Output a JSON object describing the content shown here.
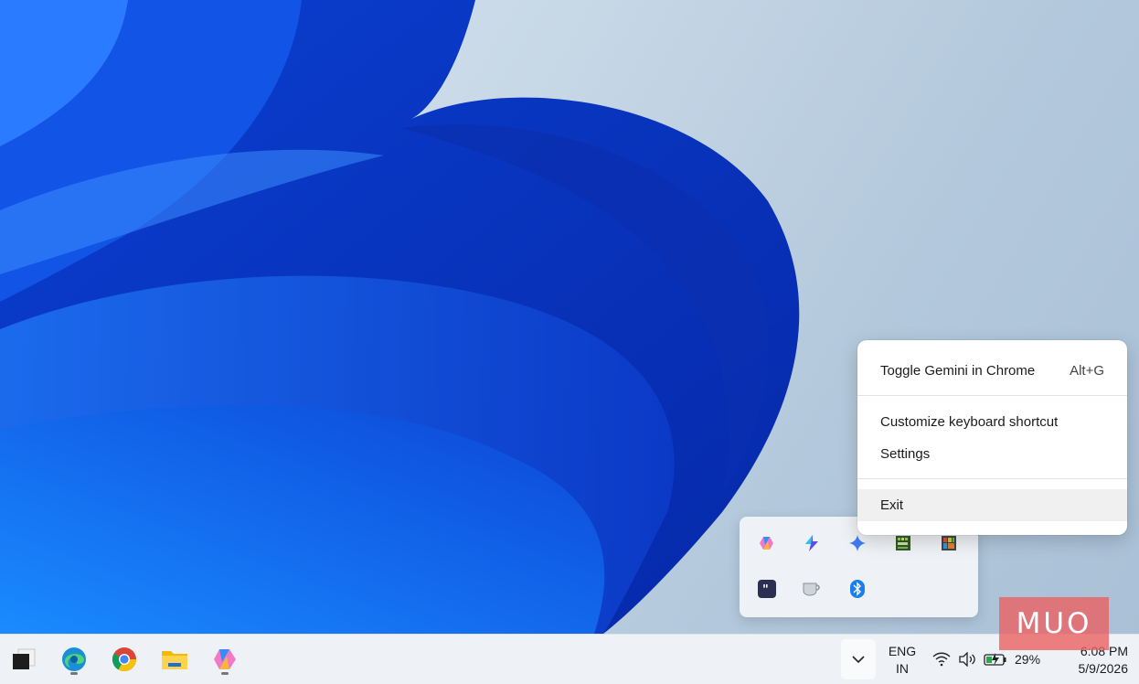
{
  "context_menu": {
    "items": [
      {
        "label": "Toggle Gemini in Chrome",
        "shortcut": "Alt+G"
      },
      {
        "label": "Customize keyboard shortcut"
      },
      {
        "label": "Settings"
      },
      {
        "label": "Exit",
        "highlighted": true
      }
    ]
  },
  "tray_overflow": {
    "icons": [
      "copilot-icon",
      "power-automate-icon",
      "gemini-sparkle-icon",
      "keyboard-app-icon",
      "palette-app-icon",
      "quote-app-icon",
      "coffee-cup-icon",
      "bluetooth-icon"
    ]
  },
  "taskbar": {
    "apps": [
      "task-view-icon",
      "edge-icon",
      "chrome-icon",
      "file-explorer-icon",
      "copilot-icon"
    ],
    "language": {
      "line1": "ENG",
      "line2": "IN"
    },
    "battery_percent": "29%",
    "time": "6:08 PM",
    "date": "5/9/2026"
  },
  "watermark": "MUO",
  "colors": {
    "accent": "#1f5fe0",
    "menu_bg": "#ffffff",
    "taskbar_bg": "#eef2f7"
  }
}
